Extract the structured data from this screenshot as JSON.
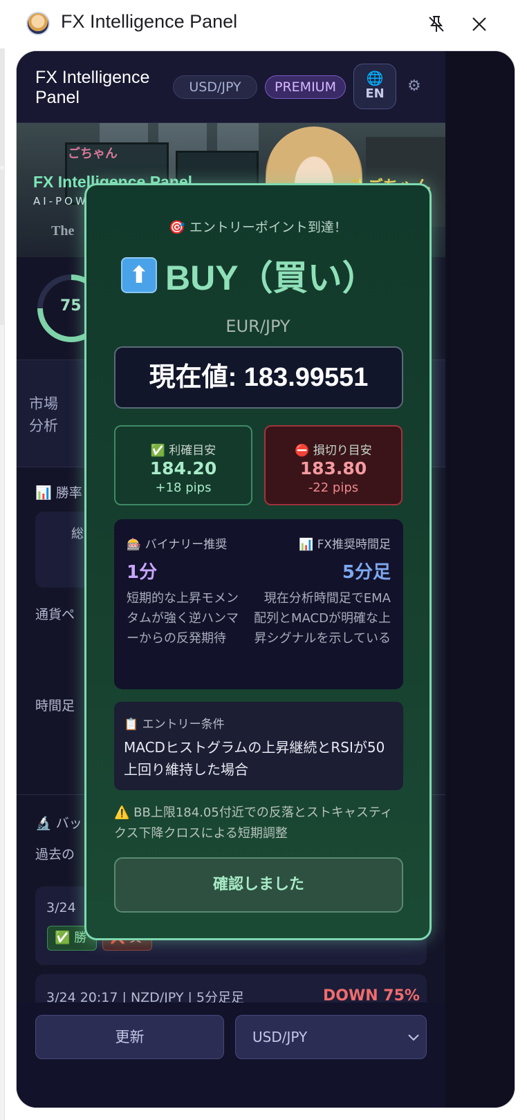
{
  "window": {
    "title": "FX Intelligence Panel"
  },
  "header": {
    "title": "FX Intelligence Panel",
    "pair_badge": "USD/JPY",
    "plan_badge": "PREMIUM",
    "language": "EN"
  },
  "banner": {
    "title": "FX Intelligence Panel",
    "subtitle": "AI-POW",
    "tagline": "The",
    "character_name": "✨ごちゃん",
    "small_name": "ごちゃん"
  },
  "score": {
    "value": "75",
    "fraction": 0.75
  },
  "market": {
    "label": "市場\n分析"
  },
  "sections": {
    "winrate_title": "勝率",
    "winrate_total": "総",
    "pair_label": "通貨ペ",
    "timeframe_label": "時間足",
    "backtest_title": "バッ",
    "backtest_desc": "過去の"
  },
  "history": [
    {
      "date": "3/24",
      "badge_win": "勝",
      "badge_lose": "負"
    },
    {
      "text": "3/24 20:17 | NZD/JPY | 5分足足",
      "result": "DOWN 75%"
    }
  ],
  "footer": {
    "refresh_label": "更新",
    "pair_select": "USD/JPY"
  },
  "modal": {
    "headline": "エントリーポイント到達！",
    "signal": "BUY（買い）",
    "pair": "EUR/JPY",
    "current_price": "現在値: 183.99551",
    "take_profit": {
      "label": "利確目安",
      "value": "184.20",
      "pips": "+18 pips"
    },
    "stop_loss": {
      "label": "損切り目安",
      "value": "183.80",
      "pips": "-22 pips"
    },
    "binary": {
      "label": "バイナリー推奨",
      "value": "1分",
      "desc": "短期的な上昇モメンタムが強く逆ハンマーからの反発期待"
    },
    "fx_timeframe": {
      "label": "FX推奨時間足",
      "value": "5分足",
      "desc": "現在分析時間足でEMA配列とMACDが明確な上昇シグナルを示している"
    },
    "entry_condition": {
      "label": "エントリー条件",
      "text": "MACDヒストグラムの上昇継続とRSIが50上回り維持した場合"
    },
    "warning": "BB上限184.05付近での反落とストキャスティクス下降クロスによる短期調整",
    "confirm_label": "確認しました"
  }
}
